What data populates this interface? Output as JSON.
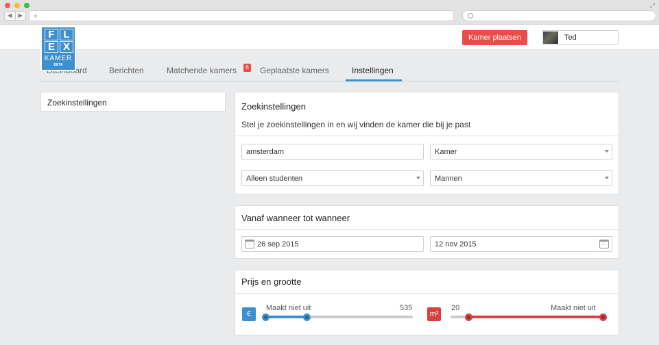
{
  "header": {
    "logo": {
      "row1": [
        "F",
        "L"
      ],
      "row2": [
        "E",
        "X"
      ],
      "kamer": "KAMER",
      "beta": "BETA"
    },
    "place_button": "Kamer plaatsen",
    "user_name": "Ted"
  },
  "tabs": [
    {
      "label": "Dashboard"
    },
    {
      "label": "Berichten"
    },
    {
      "label": "Matchende kamers",
      "badge": "6"
    },
    {
      "label": "Geplaatste kamers"
    },
    {
      "label": "Instellingen",
      "active": true
    }
  ],
  "sidebar": {
    "item": "Zoekinstellingen"
  },
  "search_card": {
    "title": "Zoekinstellingen",
    "subtitle": "Stel je zoekinstellingen in en wij vinden de kamer die bij je past",
    "city": "amsterdam",
    "type": "Kamer",
    "tenant": "Alleen studenten",
    "gender": "Mannen"
  },
  "date_card": {
    "title": "Vanaf wanneer tot wanneer",
    "from": "26 sep 2015",
    "to": "12 nov 2015"
  },
  "price_card": {
    "title": "Prijs en grootte",
    "price": {
      "symbol": "€",
      "min_label": "Maakt niet uit",
      "max_label": "535",
      "low": 0.0,
      "high": 0.28,
      "color": "#3e8fcd"
    },
    "size": {
      "symbol": "m²",
      "min_label": "20",
      "max_label": "Maakt niet uit",
      "low": 0.12,
      "high": 1.0,
      "color": "#d9413e"
    }
  },
  "colors": {
    "accent": "#3e8fcd",
    "danger": "#e74d49"
  }
}
